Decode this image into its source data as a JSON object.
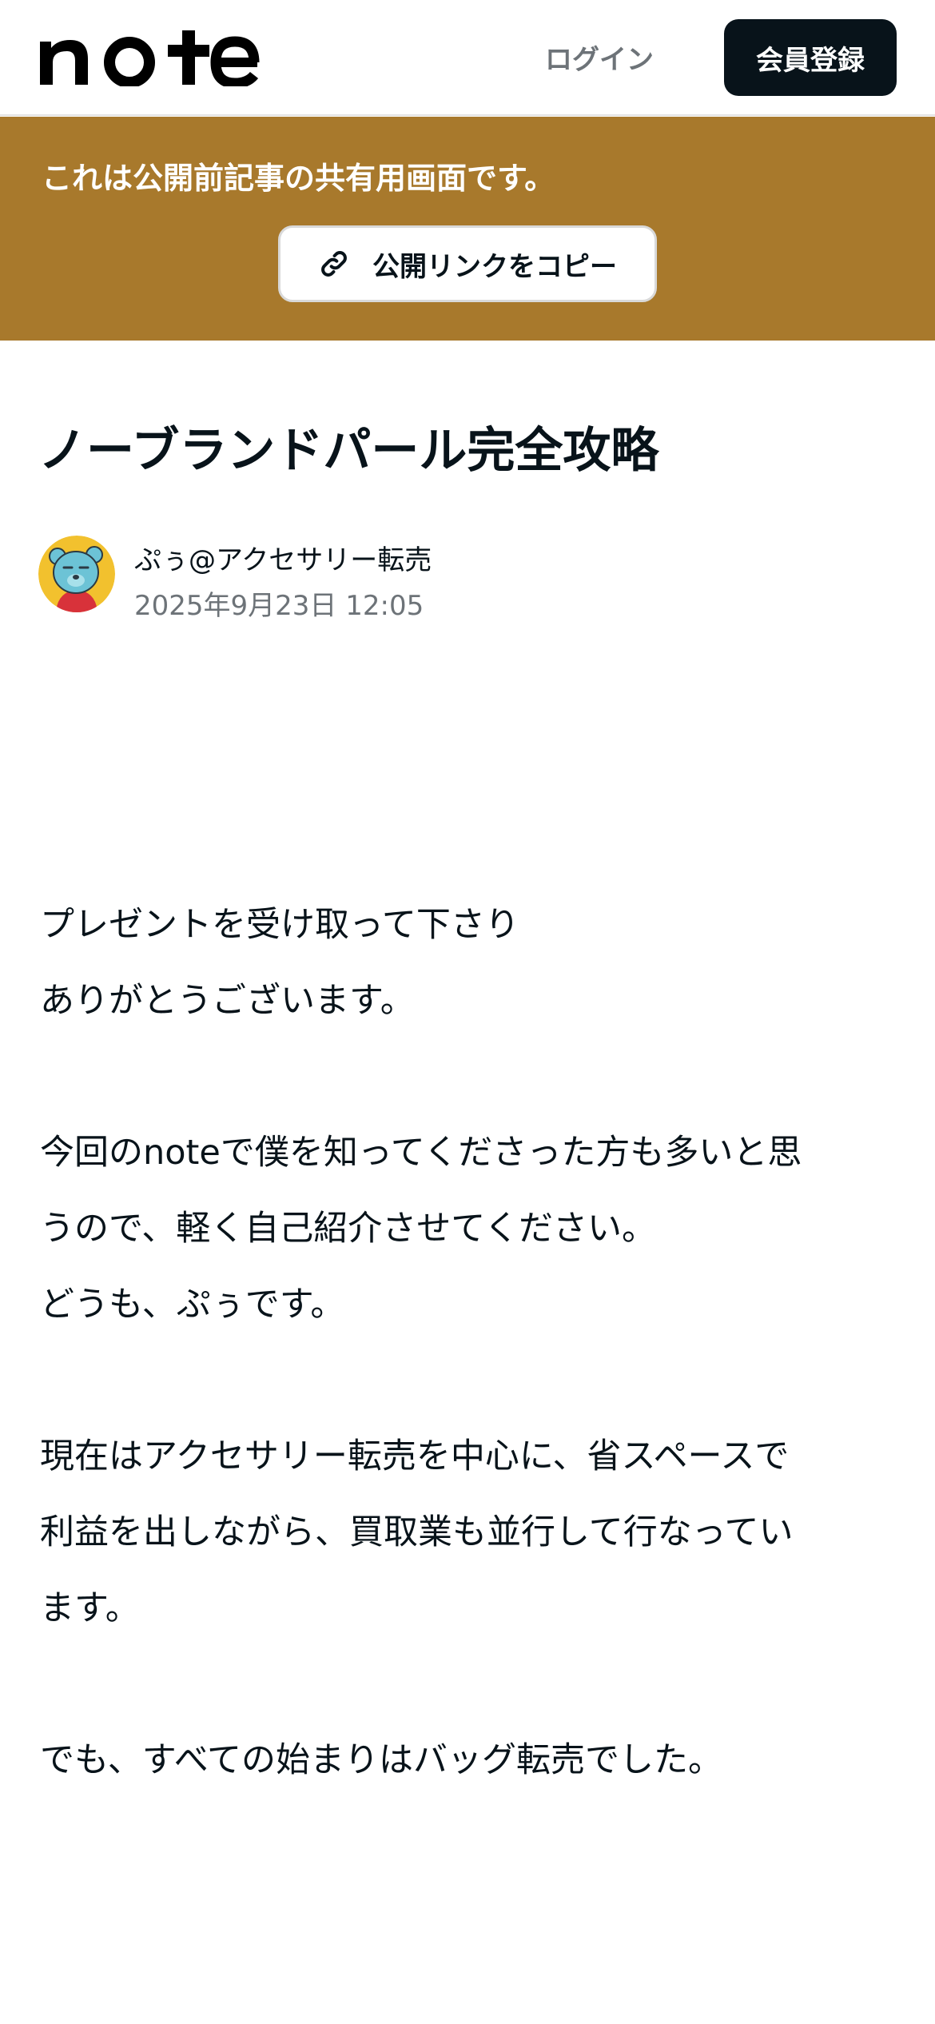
{
  "header": {
    "logo_text": "note",
    "login_label": "ログイン",
    "signup_label": "会員登録"
  },
  "banner": {
    "message": "これは公開前記事の共有用画面です。",
    "copy_link_label": "公開リンクをコピー"
  },
  "article": {
    "title": "ノーブランドパール完全攻略",
    "author": "ぷぅ@アクセサリー転売",
    "date": "2025年9月23日 12:05",
    "paragraphs": [
      [
        "プレゼントを受け取って下さり",
        "ありがとうございます。"
      ],
      [
        "今回のnoteで僕を知ってくださった方も多いと思",
        "うので、軽く自己紹介させてください。",
        "どうも、ぷぅです。"
      ],
      [
        "現在はアクセサリー転売を中心に、省スペースで",
        "利益を出しながら、買取業も並行して行なってい",
        "ます。"
      ],
      [
        "でも、すべての始まりはバッグ転売でした。"
      ]
    ]
  },
  "icons": {
    "copy_link": "link-icon",
    "avatar": "bear-avatar"
  },
  "colors": {
    "banner": "#a8792c",
    "signup_button": "#08131a",
    "text": "#08131a",
    "muted": "#6d7378"
  }
}
